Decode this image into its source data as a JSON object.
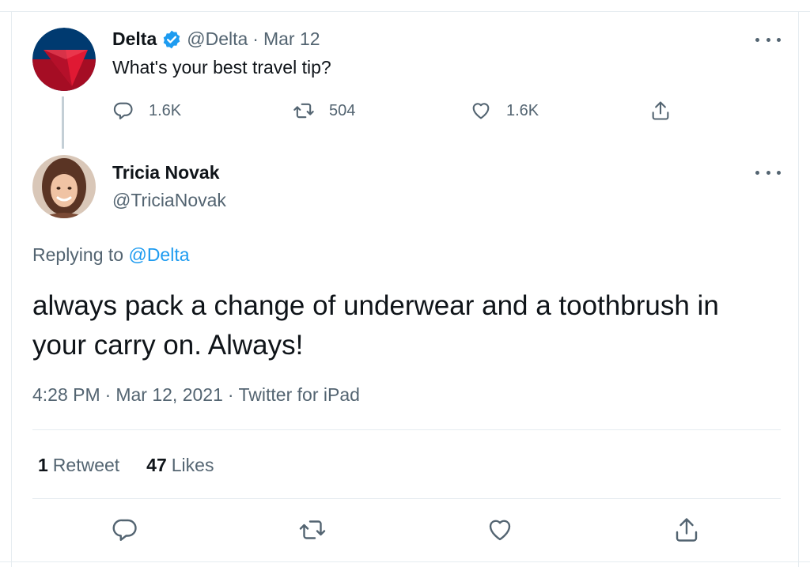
{
  "parent_tweet": {
    "name": "Delta",
    "handle": "@Delta",
    "separator": "·",
    "date": "Mar 12",
    "text": "What's your best travel tip?",
    "actions": {
      "reply_count": "1.6K",
      "retweet_count": "504",
      "like_count": "1.6K"
    }
  },
  "main_tweet": {
    "name": "Tricia Novak",
    "handle": "@TriciaNovak",
    "replying_prefix": "Replying to",
    "replying_mention": "@Delta",
    "text": "always pack a change of underwear and a toothbrush in your carry on. Always!",
    "time": "4:28 PM",
    "separator": "·",
    "date": "Mar 12, 2021",
    "source": "Twitter for iPad",
    "stats": {
      "retweet_count": "1",
      "retweet_label": "Retweet",
      "like_count": "47",
      "like_label": "Likes"
    }
  },
  "icons": {
    "more": "more-options-icon",
    "reply": "reply-icon",
    "retweet": "retweet-icon",
    "like": "like-icon",
    "share": "share-icon",
    "verified": "verified-badge-icon"
  },
  "colors": {
    "text": "#0f1419",
    "muted": "#536471",
    "link": "#1d9bf0",
    "verified": "#1d9bf0",
    "divider": "#e6ecf0",
    "delta_red": "#c8102e",
    "delta_navy": "#003a70"
  }
}
